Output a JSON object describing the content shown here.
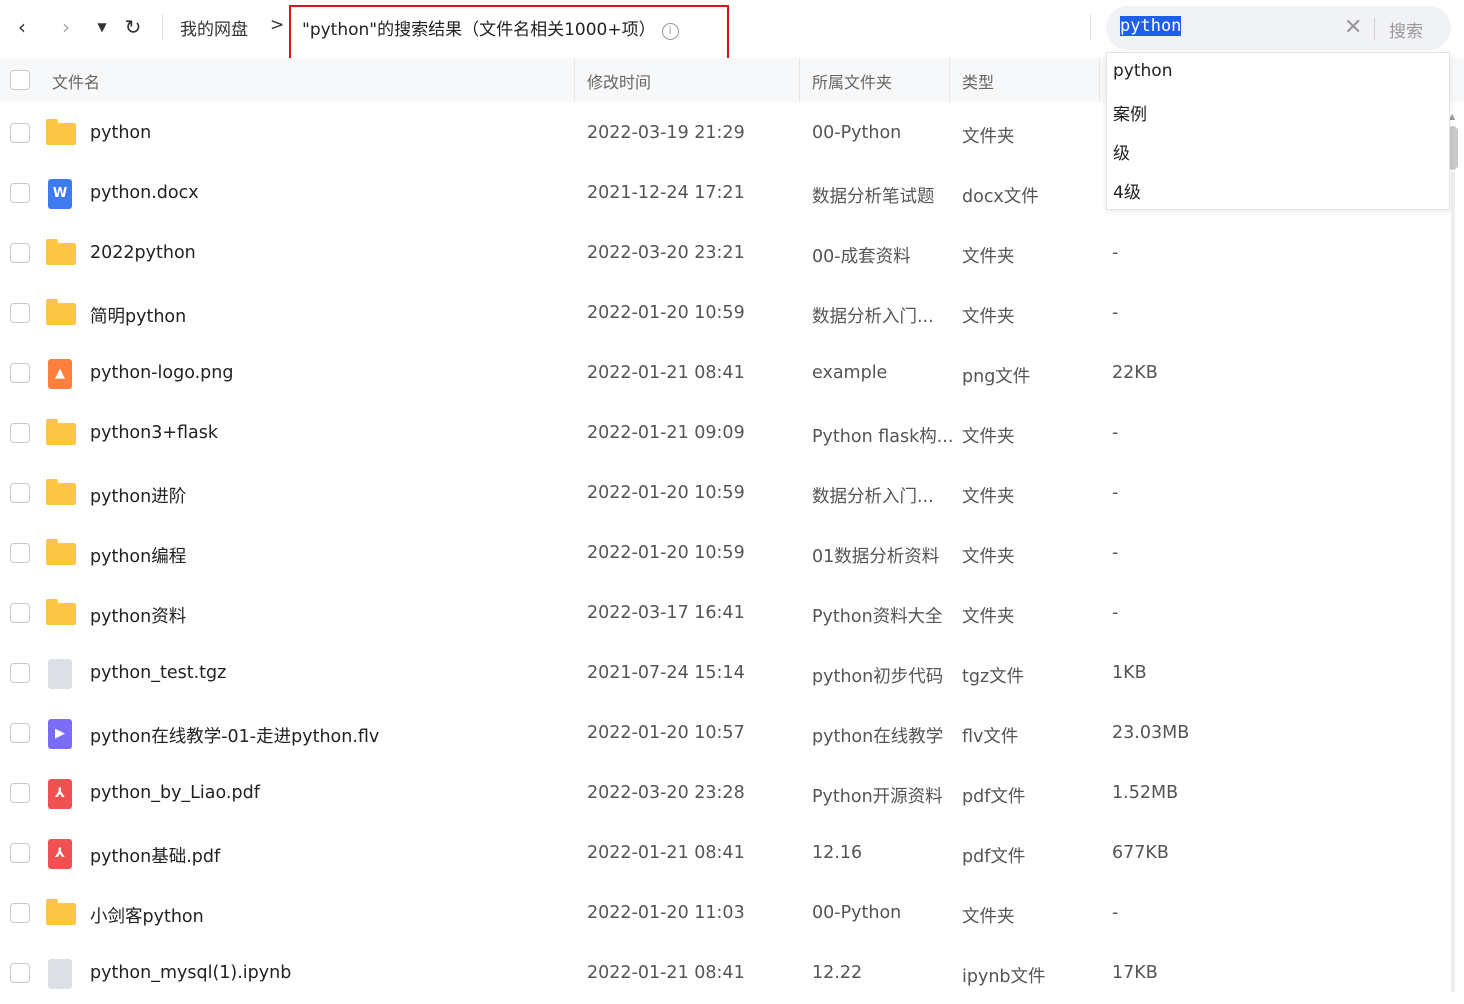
{
  "toolbar": {
    "back": "‹",
    "forward": "›",
    "dropdown": "▼",
    "refresh": "↻",
    "home": "我的网盘",
    "arrow": ">",
    "search_title": "\"python\"的搜索结果（文件名相关1000+项）",
    "info": "i"
  },
  "search": {
    "value": "python",
    "clear": "✕",
    "button": "搜索"
  },
  "suggestions": [
    "python",
    "案例",
    "级",
    "4级"
  ],
  "columns": {
    "name": "文件名",
    "time": "修改时间",
    "folder": "所属文件夹",
    "type": "类型"
  },
  "rows": [
    {
      "icon": "folder",
      "name": "python",
      "time": "2022-03-19 21:29",
      "folder": "00-Python",
      "type": "文件夹",
      "size": ""
    },
    {
      "icon": "word",
      "name": "python.docx",
      "time": "2021-12-24 17:21",
      "folder": "数据分析笔试题",
      "type": "docx文件",
      "size": ""
    },
    {
      "icon": "folder",
      "name": "2022python",
      "time": "2022-03-20 23:21",
      "folder": "00-成套资料",
      "type": "文件夹",
      "size": "-"
    },
    {
      "icon": "folder",
      "name": "简明python",
      "time": "2022-01-20 10:59",
      "folder": "数据分析入门...",
      "type": "文件夹",
      "size": "-"
    },
    {
      "icon": "img",
      "name": "python-logo.png",
      "time": "2022-01-21 08:41",
      "folder": "example",
      "type": "png文件",
      "size": "22KB"
    },
    {
      "icon": "folder",
      "name": "python3+flask",
      "time": "2022-01-21 09:09",
      "folder": "Python flask构...",
      "type": "文件夹",
      "size": "-"
    },
    {
      "icon": "folder",
      "name": "python进阶",
      "time": "2022-01-20 10:59",
      "folder": "数据分析入门...",
      "type": "文件夹",
      "size": "-"
    },
    {
      "icon": "folder",
      "name": "python编程",
      "time": "2022-01-20 10:59",
      "folder": "01数据分析资料",
      "type": "文件夹",
      "size": "-"
    },
    {
      "icon": "folder",
      "name": "python资料",
      "time": "2022-03-17 16:41",
      "folder": "Python资料大全",
      "type": "文件夹",
      "size": "-"
    },
    {
      "icon": "gray",
      "name": "python_test.tgz",
      "time": "2021-07-24 15:14",
      "folder": "python初步代码",
      "type": "tgz文件",
      "size": "1KB"
    },
    {
      "icon": "vid",
      "name": "python在线教学-01-走进python.flv",
      "time": "2022-01-20 10:57",
      "folder": "python在线教学",
      "type": "flv文件",
      "size": "23.03MB"
    },
    {
      "icon": "pdf",
      "name": "python_by_Liao.pdf",
      "time": "2022-03-20 23:28",
      "folder": "Python开源资料",
      "type": "pdf文件",
      "size": "1.52MB"
    },
    {
      "icon": "pdf",
      "name": "python基础.pdf",
      "time": "2022-01-21 08:41",
      "folder": "12.16",
      "type": "pdf文件",
      "size": "677KB"
    },
    {
      "icon": "folder",
      "name": "小剑客python",
      "time": "2022-01-20 11:03",
      "folder": "00-Python",
      "type": "文件夹",
      "size": "-"
    },
    {
      "icon": "gray",
      "name": "python_mysql(1).ipynb",
      "time": "2022-01-21 08:41",
      "folder": "12.22",
      "type": "ipynb文件",
      "size": "17KB"
    }
  ],
  "colors": {
    "folder": "#fdc645",
    "word": "#3f7bf0",
    "img": "#ff7f3e",
    "pdf": "#f05050",
    "vid": "#7b6cf6",
    "highlight_box": "#d9141c",
    "selection": "#1f5ee8"
  }
}
